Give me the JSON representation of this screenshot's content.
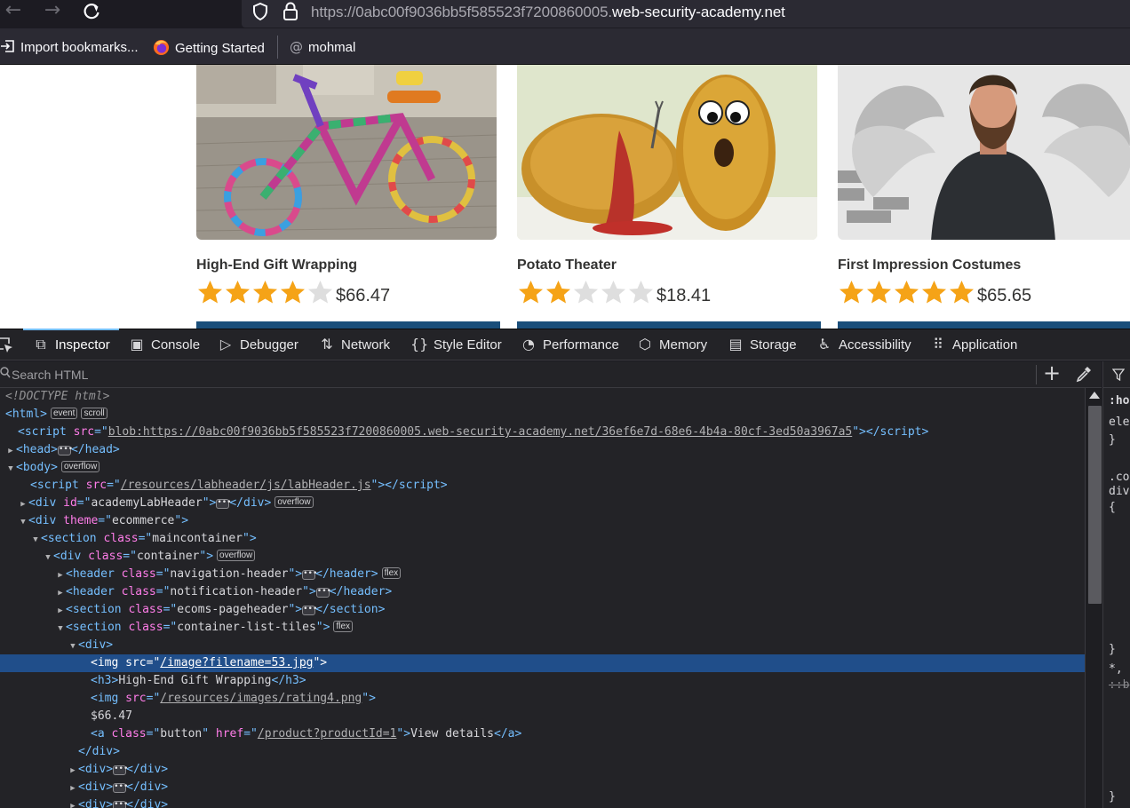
{
  "browser": {
    "url_prefix": "https://0abc00f9036bb5f585523f7200860005.",
    "url_domain": "web-security-academy.net",
    "bookmarks": [
      {
        "label": "Import bookmarks..."
      },
      {
        "label": "Getting Started"
      },
      {
        "label": "mohmal"
      }
    ]
  },
  "products": [
    {
      "name": "High-End Gift Wrapping",
      "price": "$66.47",
      "rating": 4
    },
    {
      "name": "Potato Theater",
      "price": "$18.41",
      "rating": 2
    },
    {
      "name": "First Impression Costumes",
      "price": "$65.65",
      "rating": 5
    }
  ],
  "devtools": {
    "tabs": [
      {
        "label": "Inspector",
        "icon": "inspector-icon",
        "active": true
      },
      {
        "label": "Console",
        "icon": "console-icon"
      },
      {
        "label": "Debugger",
        "icon": "debugger-icon"
      },
      {
        "label": "Network",
        "icon": "network-icon"
      },
      {
        "label": "Style Editor",
        "icon": "style-editor-icon"
      },
      {
        "label": "Performance",
        "icon": "performance-icon"
      },
      {
        "label": "Memory",
        "icon": "memory-icon"
      },
      {
        "label": "Storage",
        "icon": "storage-icon"
      },
      {
        "label": "Accessibility",
        "icon": "accessibility-icon"
      },
      {
        "label": "Application",
        "icon": "application-icon"
      }
    ],
    "search_placeholder": "Search HTML",
    "markup": {
      "doctype": "<!DOCTYPE html>",
      "html_tag": "html",
      "badge_event": "event",
      "badge_scroll": "scroll",
      "badge_overflow": "overflow",
      "badge_flex": "flex",
      "script1_src": "blob:https://0abc00f9036bb5f585523f7200860005.web-security-academy.net/36ef6e7d-68e6-4b4a-80cf-3ed50a3967a5",
      "head_tag": "head",
      "body_tag": "body",
      "script2_src": "/resources/labheader/js/labHeader.js",
      "lab_header_id": "academyLabHeader",
      "theme_value": "ecommerce",
      "maincontainer_class": "maincontainer",
      "container_class": "container",
      "nav_header_class": "navigation-header",
      "notif_header_class": "notification-header",
      "pageheader_class": "ecoms-pageheader",
      "list_tiles_class": "container-list-tiles",
      "img_src": "/image?filename=53.jpg",
      "h3_text": "High-End Gift Wrapping",
      "rating_src": "/resources/images/rating4.png",
      "price_text": "$66.47",
      "button_class": "button",
      "button_href": "/product?productId=1",
      "button_text": "View details"
    },
    "rules_panel": {
      "lines": [
        ":hov",
        "ele",
        "}",
        ".co",
        "div",
        "{",
        "}",
        "*,",
        "::b",
        "}"
      ]
    }
  }
}
